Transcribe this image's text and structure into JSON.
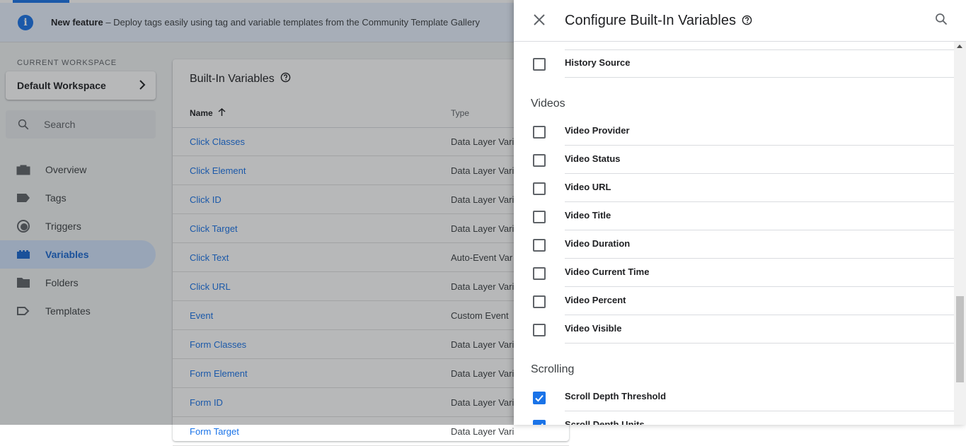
{
  "banner": {
    "title": "New feature",
    "text": " – Deploy tags easily using tag and variable templates from the Community Template Gallery"
  },
  "workspace": {
    "label": "CURRENT WORKSPACE",
    "name": "Default Workspace"
  },
  "search": {
    "placeholder": "Search"
  },
  "nav": {
    "items": [
      {
        "label": "Overview",
        "icon": "briefcase-icon"
      },
      {
        "label": "Tags",
        "icon": "tag-icon"
      },
      {
        "label": "Triggers",
        "icon": "trigger-icon"
      },
      {
        "label": "Variables",
        "icon": "variables-icon",
        "active": true
      },
      {
        "label": "Folders",
        "icon": "folder-icon"
      },
      {
        "label": "Templates",
        "icon": "template-icon"
      }
    ]
  },
  "builtin": {
    "title": "Built-In Variables",
    "col_name": "Name",
    "col_type": "Type",
    "rows": [
      {
        "name": "Click Classes",
        "type": "Data Layer Vari"
      },
      {
        "name": "Click Element",
        "type": "Data Layer Vari"
      },
      {
        "name": "Click ID",
        "type": "Data Layer Vari"
      },
      {
        "name": "Click Target",
        "type": "Data Layer Vari"
      },
      {
        "name": "Click Text",
        "type": "Auto-Event Var"
      },
      {
        "name": "Click URL",
        "type": "Data Layer Vari"
      },
      {
        "name": "Event",
        "type": "Custom Event"
      },
      {
        "name": "Form Classes",
        "type": "Data Layer Vari"
      },
      {
        "name": "Form Element",
        "type": "Data Layer Vari"
      },
      {
        "name": "Form ID",
        "type": "Data Layer Vari"
      },
      {
        "name": "Form Target",
        "type": "Data Layer Vari"
      }
    ]
  },
  "drawer": {
    "title": "Configure Built-In Variables",
    "history_item": "History Source",
    "sections": {
      "videos": "Videos",
      "scrolling": "Scrolling"
    },
    "videos": [
      {
        "label": "Video Provider",
        "checked": false
      },
      {
        "label": "Video Status",
        "checked": false
      },
      {
        "label": "Video URL",
        "checked": false
      },
      {
        "label": "Video Title",
        "checked": false
      },
      {
        "label": "Video Duration",
        "checked": false
      },
      {
        "label": "Video Current Time",
        "checked": false
      },
      {
        "label": "Video Percent",
        "checked": false
      },
      {
        "label": "Video Visible",
        "checked": false
      }
    ],
    "scrolling": [
      {
        "label": "Scroll Depth Threshold",
        "checked": true
      },
      {
        "label": "Scroll Depth Units",
        "checked": true
      }
    ]
  },
  "colors": {
    "accent": "#1a73e8",
    "active_nav_bg": "#d2e3fc",
    "banner_bg": "#e8f0fe"
  }
}
